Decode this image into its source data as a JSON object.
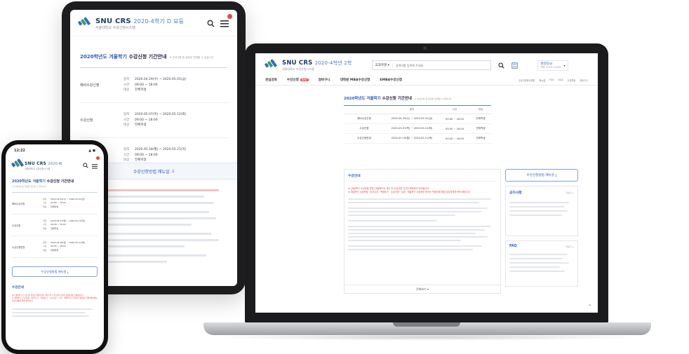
{
  "brand": {
    "name": "SNU CRS",
    "year_tablet": "2020-4학기 D 묘둥",
    "year_laptop": "2020-4학년 2학",
    "year_phone": "2020-W",
    "subtitle": "서울대학교 수강신청시스템"
  },
  "period": {
    "title_prefix": "2020학년도 겨울학기",
    "title_main": "수강신청 기간안내",
    "note": "※ 안내사항 중 일정은 변경될 수 있습니다"
  },
  "schedule": [
    {
      "name": "예비수강신청",
      "date": "2020.04.29(수) ~ 2020.05.01(금)",
      "time": "09:00 ~ 18:00",
      "target": "전체학생"
    },
    {
      "name": "수강신청",
      "date": "2020.05.07(목) ~ 2020.05.12(화)",
      "time": "09:00 ~ 18:00",
      "target": "전체학생"
    },
    {
      "name": "수강신청변경",
      "date": "2020.05.18(월) ~ 2020.05.21(목)",
      "time": "09:00 ~ 18:00",
      "target": "전체학생"
    }
  ],
  "kv_labels": {
    "date": "일자",
    "time": "시간",
    "target": "대상"
  },
  "laptop_table_headers": [
    "",
    "일자",
    "시간",
    "대상"
  ],
  "download_label": "수강신청방법 매뉴얼",
  "guide_title": "수강안내",
  "guide_notice_1": "★ [개설학기 수강신청 관련] 개설학기는 개인 후 수강신청 기간이 확정되어 안내됩니다.",
  "guide_notice_2": "★ 계절학기 수강학점 · 외국수강 · 학점포기 · 수강신청 · 수업 · 계절학기 수업관련 문의는 학생처에 해당 담당자에게 문의 바랍니다.",
  "more_label": "전체보기",
  "laptop": {
    "search_select": "교과목명",
    "search_placeholder": "검색어를 입력해 주세요",
    "user_name": "홍길동님",
    "user_sub": "학번 2020-12345",
    "nav": [
      "관심강좌",
      "수강신청",
      "장바구니",
      "대학원 MBA수강신청",
      "EMBA수강신청"
    ],
    "nav_badge": "NEW",
    "util_links": [
      "수강신청하는방법",
      "매뉴얼",
      "FAQ",
      "Q&A",
      "수강편람",
      "장바구니"
    ],
    "notice_title": "공지사항",
    "notice_more": "더보기 +",
    "faq_title": "FAQ",
    "faq_more": "더보기 +"
  },
  "phone": {
    "time": "12:22",
    "status": "▲ ◼"
  },
  "icons": {
    "search": "search-icon",
    "menu": "menu-icon",
    "download": "download-icon",
    "chevron": "chevron-down-icon"
  }
}
